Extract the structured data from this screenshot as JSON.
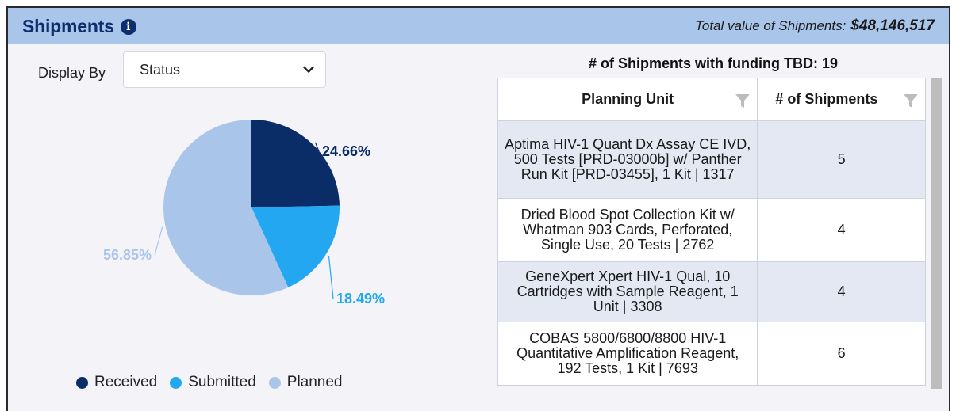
{
  "header": {
    "title": "Shipments",
    "info_icon": "info-circle-icon",
    "total_label": "Total value of Shipments:",
    "total_value": "$48,146,517"
  },
  "display_by": {
    "label": "Display By",
    "selected": "Status"
  },
  "chart_data": {
    "type": "pie",
    "title": "",
    "slices": [
      {
        "label": "Received",
        "value": 24.66,
        "display": "24.66%",
        "color": "#0b2d67"
      },
      {
        "label": "Submitted",
        "value": 18.49,
        "display": "18.49%",
        "color": "#22a7f0"
      },
      {
        "label": "Planned",
        "value": 56.85,
        "display": "56.85%",
        "color": "#a9c6ea"
      }
    ],
    "legend_position": "bottom"
  },
  "table": {
    "title": "# of Shipments with funding TBD: 19",
    "columns": [
      "Planning Unit",
      "# of Shipments"
    ],
    "rows": [
      {
        "planning_unit": "Aptima HIV-1 Quant Dx Assay CE IVD, 500 Tests [PRD-03000b] w/ Panther Run Kit [PRD-03455], 1 Kit | 1317",
        "shipments": "5"
      },
      {
        "planning_unit": "Dried Blood Spot Collection Kit w/ Whatman 903 Cards, Perforated, Single Use, 20 Tests | 2762",
        "shipments": "4"
      },
      {
        "planning_unit": "GeneXpert Xpert HIV-1 Qual, 10 Cartridges with Sample Reagent, 1 Unit | 3308",
        "shipments": "4"
      },
      {
        "planning_unit": "COBAS 5800/6800/8800 HIV-1 Quantitative Amplification Reagent, 192 Tests, 1 Kit | 7693",
        "shipments": "6"
      }
    ]
  }
}
